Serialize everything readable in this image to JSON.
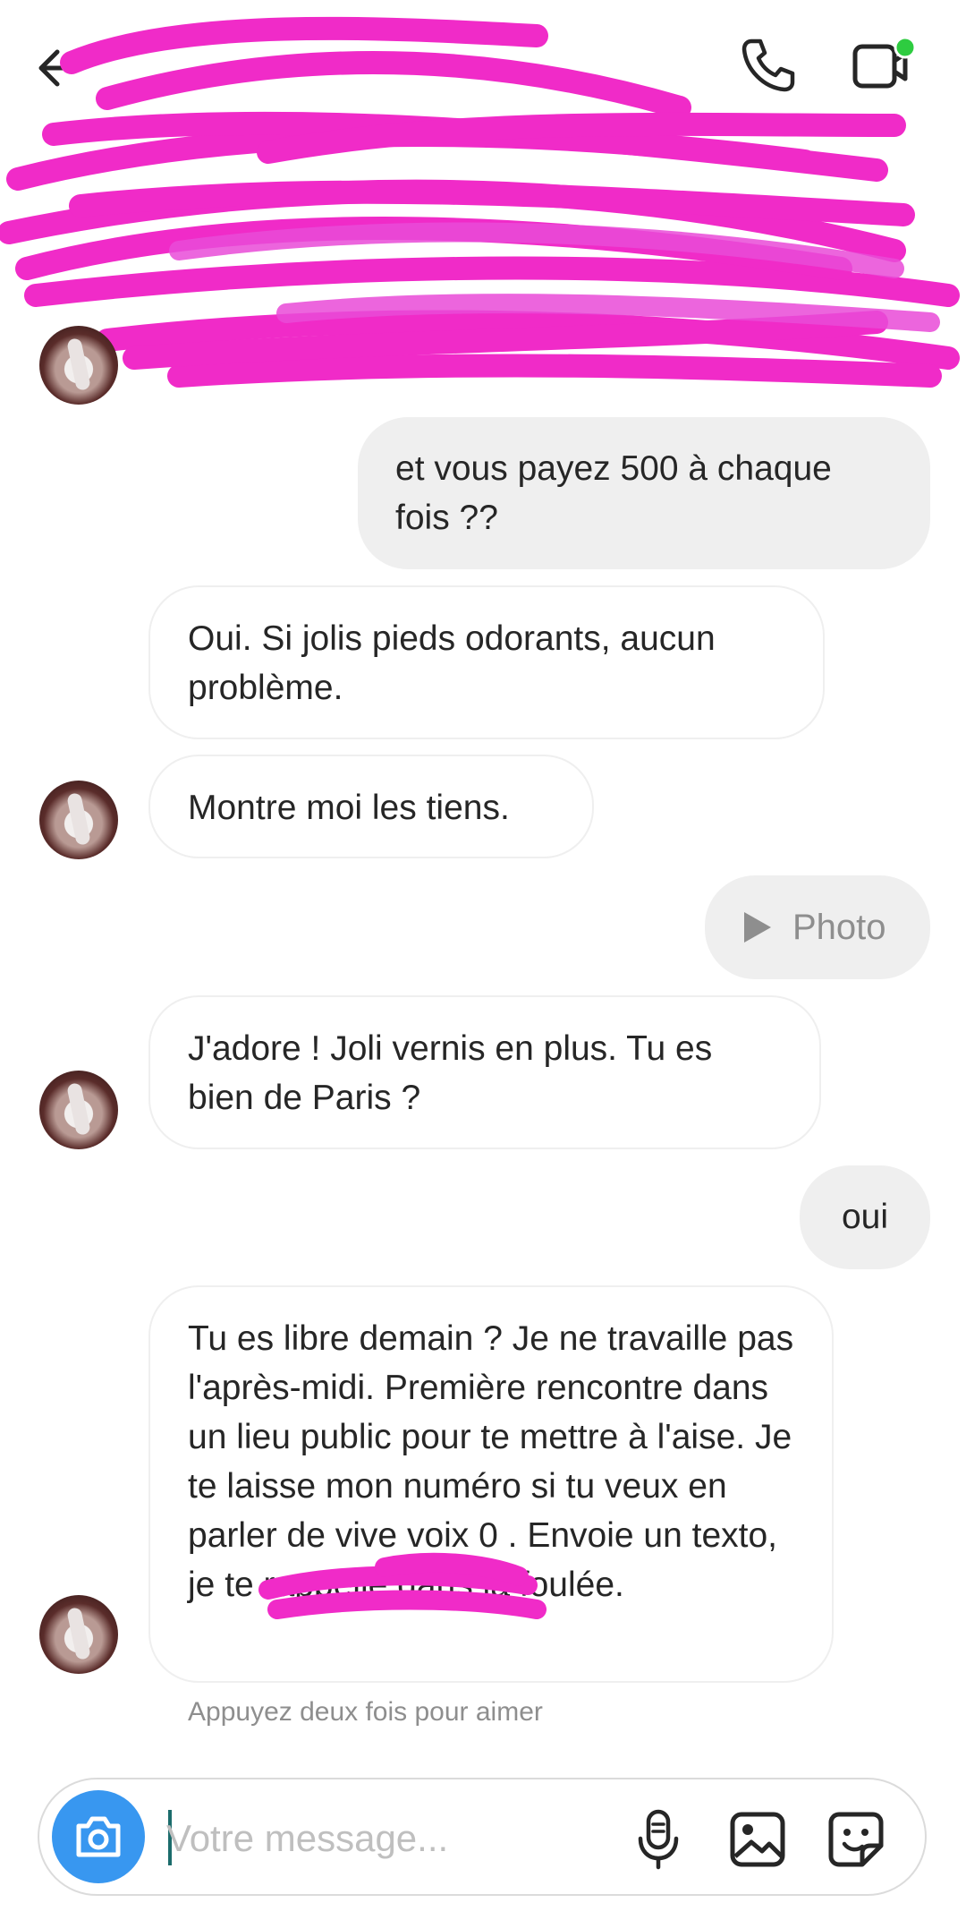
{
  "header": {
    "title": "",
    "subtitle": "",
    "back_icon": "arrow-left-icon",
    "call_icon": "phone-icon",
    "video_icon": "video-camera-icon",
    "colors": {
      "online_dot": "#2ecc40"
    }
  },
  "messages": [
    {
      "from": "me",
      "text": "et vous payez 500 à chaque fois ??"
    },
    {
      "from": "them",
      "text": "Oui. Si jolis pieds odorants, aucun problème."
    },
    {
      "from": "them",
      "text": "Montre moi les tiens."
    },
    {
      "from": "me",
      "type": "photo",
      "text": "Photo"
    },
    {
      "from": "them",
      "text": "J'adore ! Joli vernis en plus. Tu es bien de Paris ?"
    },
    {
      "from": "me",
      "text": "oui"
    },
    {
      "from": "them",
      "text": "Tu es libre demain ? Je ne travaille pas l'après-midi. Première rencontre dans un lieu public pour te mettre à l'aise. Je te laisse mon numéro si tu veux en parler de vive voix 0                . Envoie un texto, je te rappelle dans la foulée."
    }
  ],
  "like_hint": "Appuyez deux fois pour aimer",
  "composer": {
    "placeholder": "Votre message...",
    "camera_icon": "camera-icon",
    "mic_icon": "microphone-icon",
    "gallery_icon": "image-icon",
    "sticker_icon": "sticker-icon",
    "colors": {
      "camera_button": "#3897f0"
    }
  },
  "colors": {
    "redaction": "#f02bc8",
    "bubble_out": "#efefef",
    "bubble_in_border": "#efefef"
  }
}
